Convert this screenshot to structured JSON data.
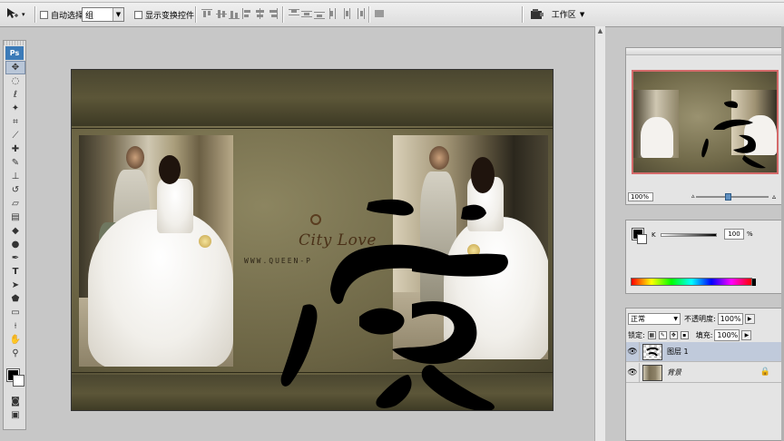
{
  "options_bar": {
    "tool_icon": "move-tool-icon",
    "auto_select_label": "自动选择:",
    "auto_select_value": "组",
    "show_transform_label": "显示变换控件",
    "workspace_label": "工作区"
  },
  "toolbox": {
    "logo": "Ps",
    "tools": [
      "move-tool-icon",
      "marquee-tool-icon",
      "lasso-tool-icon",
      "magic-wand-icon",
      "crop-tool-icon",
      "slice-tool-icon",
      "healing-brush-icon",
      "brush-tool-icon",
      "clone-stamp-icon",
      "history-brush-icon",
      "eraser-icon",
      "gradient-tool-icon",
      "blur-tool-icon",
      "dodge-tool-icon",
      "pen-tool-icon",
      "type-tool-icon",
      "path-select-icon",
      "shape-tool-icon",
      "notes-tool-icon",
      "eyedropper-icon",
      "hand-tool-icon",
      "zoom-tool-icon"
    ]
  },
  "document": {
    "logo_text": "City Love",
    "logo_sub": "WWW.QUEEN-P"
  },
  "navigator": {
    "zoom_value": "100%",
    "zoom_slider_fraction": 0.45
  },
  "color_panel": {
    "channel_label": "K",
    "channel_value": "100",
    "channel_unit": "%"
  },
  "layers_panel": {
    "blend_mode": "正常",
    "opacity_label": "不透明度:",
    "opacity_value": "100%",
    "lock_label": "锁定:",
    "fill_label": "填充:",
    "fill_value": "100%",
    "layers": [
      {
        "name": "图层 1",
        "selected": true
      },
      {
        "name": "背景",
        "selected": false
      }
    ]
  }
}
